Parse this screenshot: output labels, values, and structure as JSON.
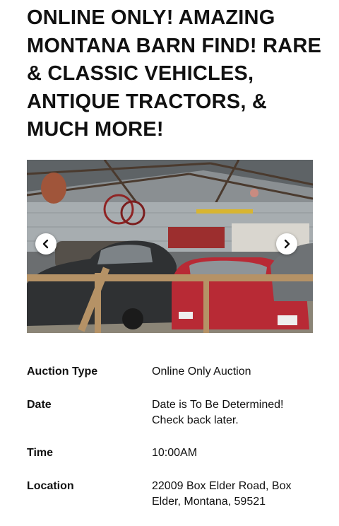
{
  "listing": {
    "title": "ONLINE ONLY! AMAZING MONTANA BARN FIND! RARE & CLASSIC VEHICLES, ANTIQUE TRACTORS, & MUCH MORE!"
  },
  "gallery": {
    "prev_icon": "chevron-left-icon",
    "next_icon": "chevron-right-icon"
  },
  "details": {
    "auction_type": {
      "label": "Auction Type",
      "value": "Online Only Auction"
    },
    "date": {
      "label": "Date",
      "value": "Date is To Be Determined! Check back later."
    },
    "time": {
      "label": "Time",
      "value": "10:00AM"
    },
    "location": {
      "label": "Location",
      "value": "22009 Box Elder Road, Box Elder, Montana, 59521"
    }
  }
}
